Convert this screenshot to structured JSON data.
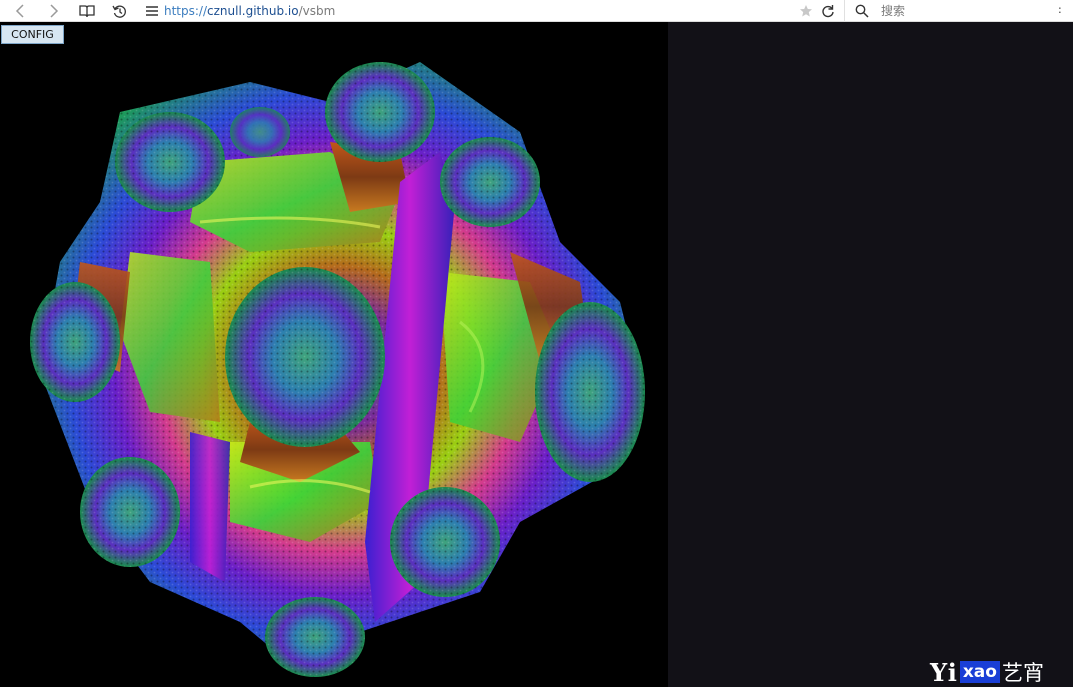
{
  "browser": {
    "url_protocol": "https://",
    "url_host": "cznull.github.io",
    "url_path": "/vsbm",
    "search_placeholder": "搜索",
    "icons": [
      "back-icon",
      "forward-icon",
      "reader-icon",
      "history-icon",
      "menu-icon",
      "star-icon",
      "reload-icon",
      "search-icon"
    ]
  },
  "app": {
    "config_label": "CONFIG"
  },
  "watermark": {
    "brand_latin": "Yi",
    "brand_badge": "xao",
    "brand_cn": "艺宵"
  },
  "colors": {
    "viewport_bg": "#000000",
    "side_bg": "#121117",
    "badge": "#1a3fd6"
  }
}
